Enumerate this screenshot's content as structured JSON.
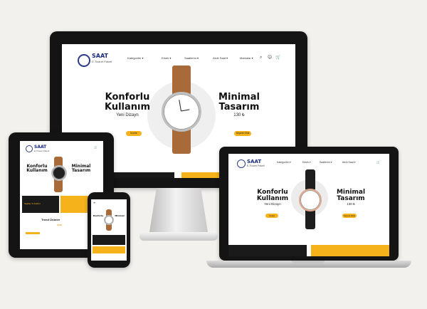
{
  "logo": {
    "title": "SAAT",
    "subtitle": "E-Ticaret Paketi"
  },
  "nav": [
    "Kategoriler ▾",
    "Erkek ▾",
    "Saatlerim ▾",
    "Akıllı Saat ▾",
    "Markalar ▾"
  ],
  "hero": {
    "left_line1": "Konforlu",
    "left_line2": "Kullanım",
    "left_sub": "Yeni Dizayn",
    "right_line1": "Minimal",
    "right_line2": "Tasarım",
    "right_sub": "130 ₺",
    "cta": "İncele",
    "cta_right": "Sepete Ekle"
  },
  "small": {
    "banner_text": "Saatler % İndirim",
    "trend": "Trend Ürünler",
    "price": "299₺"
  },
  "icons": {
    "search": "search-icon",
    "user": "user-icon",
    "cart": "cart-icon"
  },
  "colors": {
    "accent": "#f5b21b",
    "brand": "#1a2a7a",
    "strap_brown": "#a86a38"
  }
}
